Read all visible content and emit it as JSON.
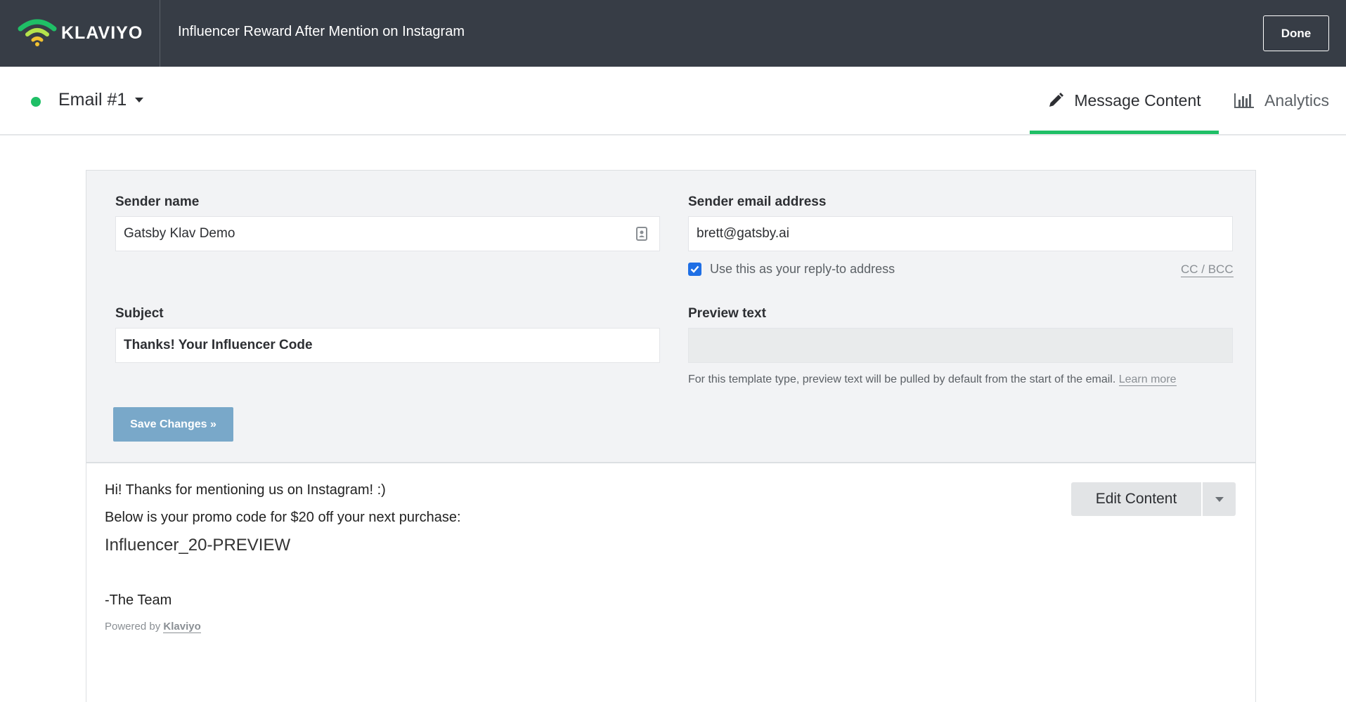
{
  "topbar": {
    "logo_text": "KLAVIYO",
    "flow_title": "Influencer Reward After Mention on Instagram",
    "done_label": "Done"
  },
  "subheader": {
    "email_name": "Email #1",
    "status_color": "#1fbf66",
    "tabs": [
      {
        "label": "Message Content",
        "icon": "pencil-icon",
        "active": true
      },
      {
        "label": "Analytics",
        "icon": "bar-chart-icon",
        "active": false
      }
    ]
  },
  "form": {
    "sender_name": {
      "label": "Sender name",
      "value": "Gatsby Klav Demo"
    },
    "sender_email": {
      "label": "Sender email address",
      "value": "brett@gatsby.ai"
    },
    "reply_to": {
      "label": "Use this as your reply-to address",
      "checked": true
    },
    "cc_bcc": "CC / BCC",
    "subject": {
      "label": "Subject",
      "value": "Thanks! Your Influencer Code"
    },
    "preview_text": {
      "label": "Preview text",
      "value": ""
    },
    "help_text": "For this template type, preview text will be pulled by default from the start of the email.",
    "learn_more": "Learn more",
    "save_label": "Save Changes »"
  },
  "preview": {
    "greeting": "Hi! Thanks for mentioning us on Instagram! :)",
    "promo_line": "Below is your promo code for $20 off your next purchase:",
    "code": "Influencer_20-PREVIEW",
    "signoff": "-The Team",
    "powered_by": "Powered by",
    "powered_brand": "Klaviyo",
    "edit_label": "Edit Content"
  }
}
